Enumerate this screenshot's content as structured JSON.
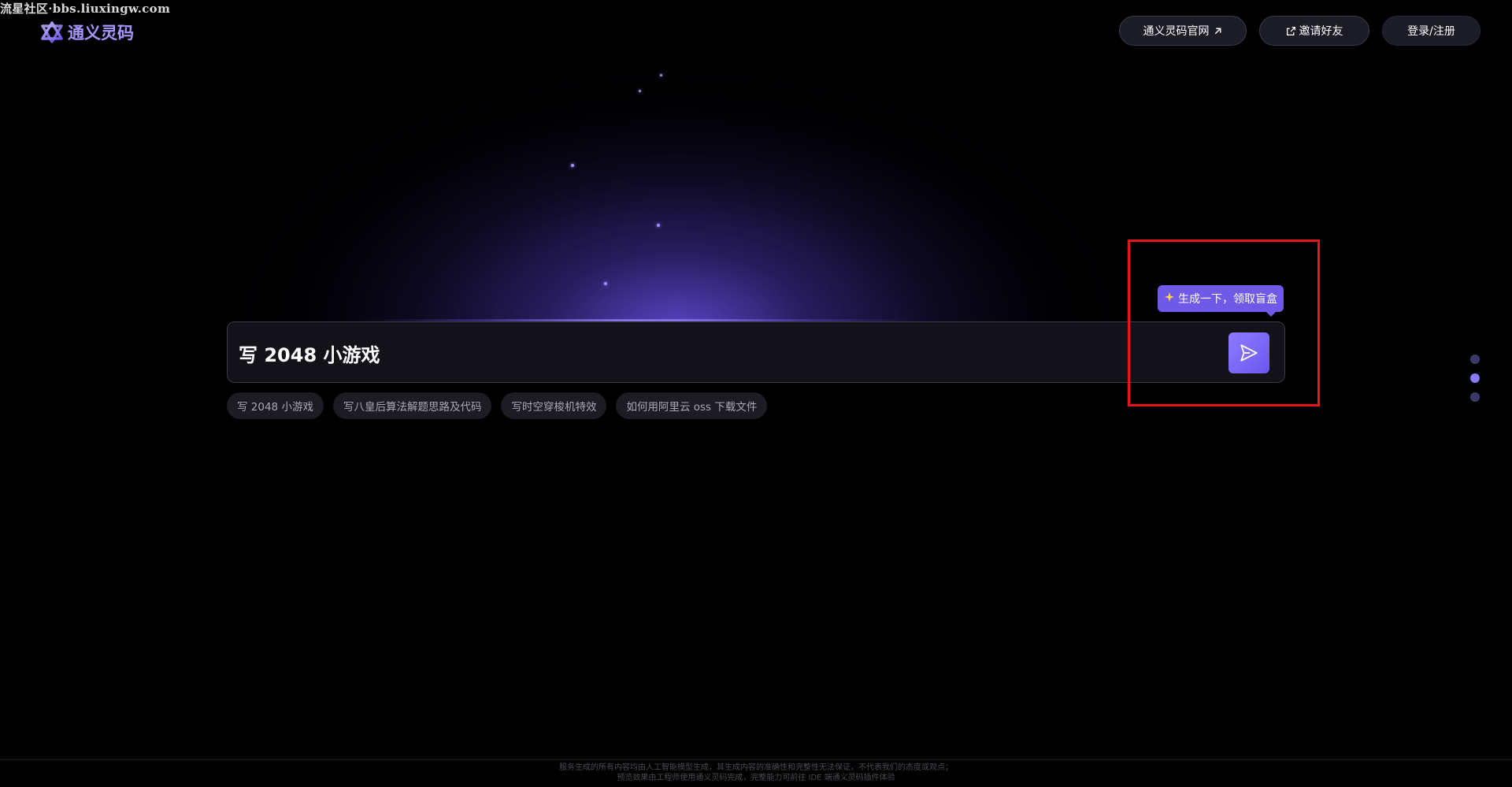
{
  "watermark": "流星社区·bbs.liuxingw.com",
  "header": {
    "logo_text": "通义灵码",
    "official_site_label": "通义灵码官网",
    "invite_label": "邀请好友",
    "login_label": "登录/注册"
  },
  "search": {
    "value": "写 2048 小游戏",
    "send_icon": "send-icon"
  },
  "tooltip": {
    "icon": "sparkle-icon",
    "text": "生成一下，领取盲盒"
  },
  "suggestions": [
    "写 2048 小游戏",
    "写八皇后算法解题思路及代码",
    "写时空穿梭机特效",
    "如何用阿里云 oss 下载文件"
  ],
  "pagination": {
    "count": 3,
    "active_index": 1
  },
  "footer": {
    "line1": "服务生成的所有内容均由人工智能模型生成，其生成内容的准确性和完整性无法保证，不代表我们的态度或观点；",
    "line2": "预览效果由工程师使用通义灵码完成，完整能力可前往 IDE 端通义灵码插件体验"
  },
  "colors": {
    "accent": "#6f5ae8",
    "logo": "#a896ff",
    "highlight": "#e5141e"
  }
}
